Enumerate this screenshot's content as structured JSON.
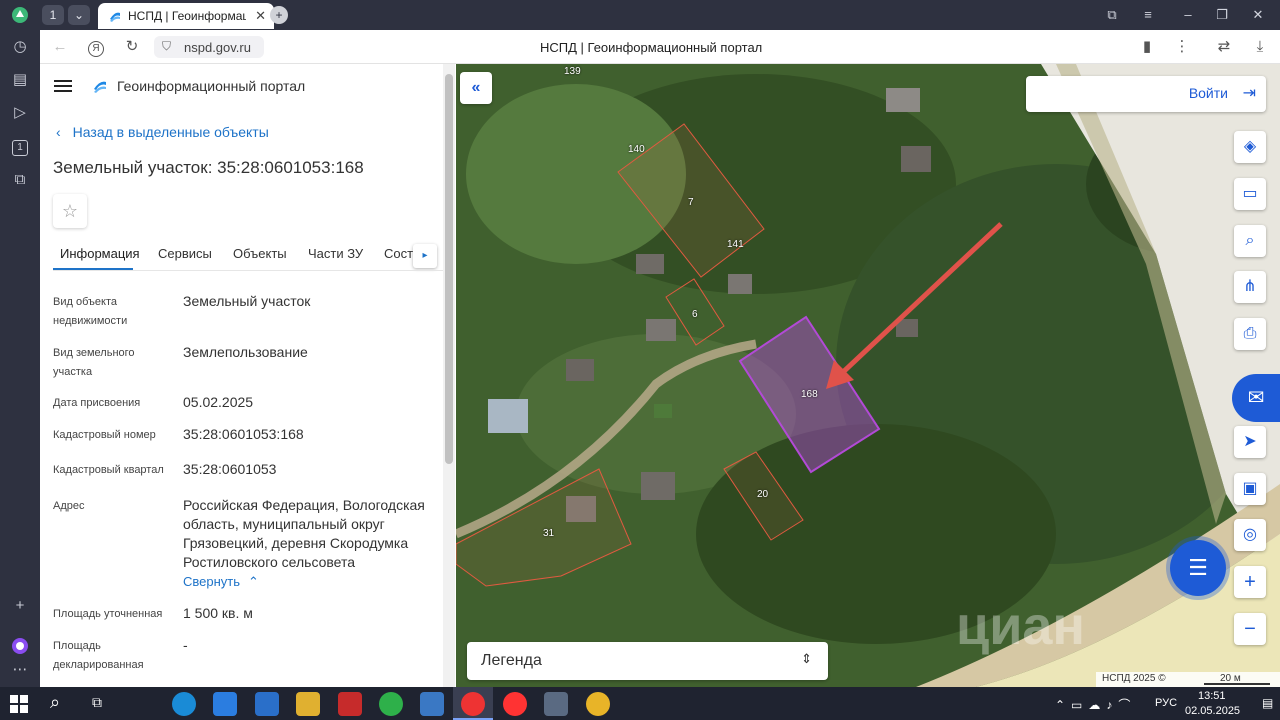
{
  "browser": {
    "tab_count": "1",
    "tab_title": "НСПД | Геоинформацио",
    "url": "nspd.gov.ru",
    "page_title": "НСПД | Геоинформационный портал"
  },
  "panel": {
    "portal_name": "Геоинформационный портал",
    "back_link": "Назад в выделенные объекты",
    "object_title": "Земельный участок: 35:28:0601053:168",
    "tabs": [
      "Информация",
      "Сервисы",
      "Объекты",
      "Части ЗУ",
      "Соста"
    ],
    "fields": [
      {
        "label": "Вид объекта недвижимости",
        "value": "Земельный участок"
      },
      {
        "label": "Вид земельного участка",
        "value": "Землепользование"
      },
      {
        "label": "Дата присвоения",
        "value": "05.02.2025"
      },
      {
        "label": "Кадастровый номер",
        "value": "35:28:0601053:168"
      },
      {
        "label": "Кадастровый квартал",
        "value": "35:28:0601053"
      },
      {
        "label": "Адрес",
        "value": "Российская Федерация, Вологодская область, муниципальный округ Грязовецкий, деревня Скородумка Ростиловского сельсовета"
      },
      {
        "label": "Площадь уточненная",
        "value": "1 500 кв. м"
      },
      {
        "label": "Площадь декларированная",
        "value": "-"
      }
    ],
    "collapse_link": "Свернуть"
  },
  "map": {
    "login_label": "Войти",
    "legend_label": "Легенда",
    "attribution": "НСПД 2025 ©",
    "scale_label": "20 м",
    "parcel_labels": [
      "139",
      "140",
      "7",
      "141",
      "6",
      "168",
      "20",
      "31"
    ],
    "watermark": "циан",
    "colors": {
      "parcel": "#e05a40",
      "selected": "#b24ad6",
      "arrow": "#e0524a",
      "accent": "#1e5bd6"
    }
  },
  "taskbar": {
    "time": "13:51",
    "date": "02.05.2025",
    "lang": "РУС"
  }
}
